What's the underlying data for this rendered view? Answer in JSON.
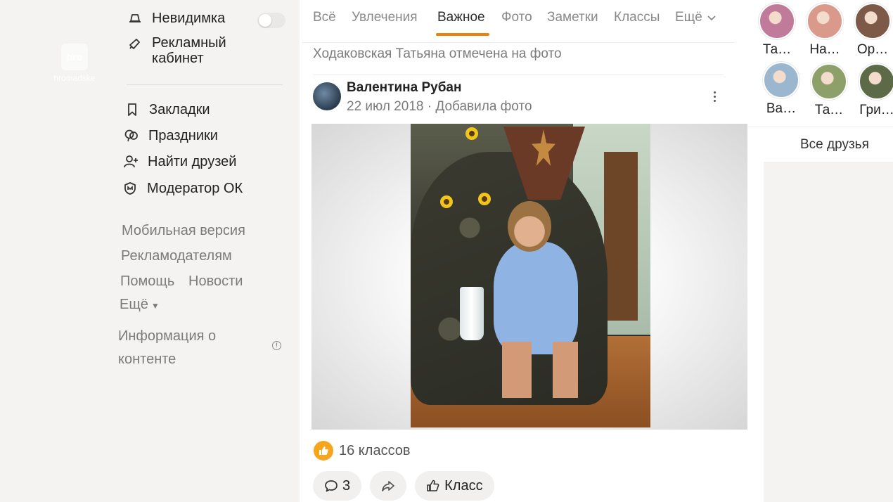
{
  "watermark": {
    "logo_text": "hro",
    "caption": "hromadske"
  },
  "left_nav": {
    "invisible_label": "Невидимка",
    "ad_cabinet_label_line1": "Рекламный",
    "ad_cabinet_label_line2": "кабинет",
    "items": [
      {
        "label": "Закладки",
        "icon": "bookmark-icon"
      },
      {
        "label": "Праздники",
        "icon": "balloons-icon"
      },
      {
        "label": "Найти друзей",
        "icon": "add-friend-icon"
      },
      {
        "label": "Модератор ОК",
        "icon": "moderator-icon"
      }
    ],
    "footer": {
      "mobile": "Мобильная версия",
      "advertisers": "Рекламодателям",
      "help": "Помощь",
      "news": "Новости",
      "more": "Ещё",
      "content_info_line1": "Информация о",
      "content_info_line2": "контенте"
    }
  },
  "feed": {
    "tabs": [
      "Всё",
      "Увлечения",
      "Важное",
      "Фото",
      "Заметки",
      "Классы",
      "Ещё"
    ],
    "active_tab": "Важное",
    "notice": "Ходаковская Татьяна отмечена на фото",
    "post": {
      "author": "Валентина Рубан",
      "meta": "22 июл 2018 · Добавила фото",
      "likes_text": "16 классов",
      "comments_count": "3",
      "class_label": "Класс"
    }
  },
  "friends": {
    "list": [
      {
        "name": "Та…",
        "color": "#c07b9b"
      },
      {
        "name": "На…",
        "color": "#d99a8c"
      },
      {
        "name": "Ор…",
        "color": "#7d5a48"
      },
      {
        "name": "Ва…",
        "color": "#9bb7cf"
      },
      {
        "name": "Та…",
        "color": "#8da06a"
      },
      {
        "name": "Гри…",
        "color": "#5d6a48"
      }
    ],
    "all_label": "Все друзья"
  },
  "colors": {
    "accent": "#ee8208",
    "like": "#f7a51c"
  }
}
